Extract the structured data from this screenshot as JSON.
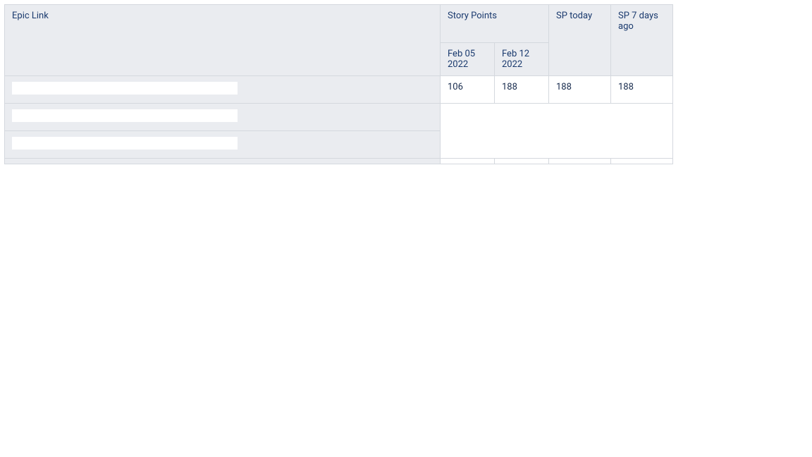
{
  "headers": {
    "epic_link": "Epic Link",
    "story_points": "Story Points",
    "sp_today": "SP today",
    "sp_7_days_ago": "SP 7 days ago",
    "date_1": "Feb 05 2022",
    "date_2": "Feb 12 2022"
  },
  "rows": [
    {
      "epic": "",
      "sp_feb05": 106,
      "sp_feb12": 188,
      "sp_today": 188,
      "sp_7days": 188
    },
    {
      "epic": "",
      "sp_feb05": null,
      "sp_feb12": null,
      "sp_today": null,
      "sp_7days": null
    },
    {
      "epic": "",
      "sp_feb05": null,
      "sp_feb12": null,
      "sp_today": null,
      "sp_7days": null
    }
  ],
  "chart_data": {
    "type": "table",
    "title": "",
    "row_dimension": "Epic Link",
    "columns": [
      {
        "group": "Story Points",
        "label": "Feb 05 2022"
      },
      {
        "group": "Story Points",
        "label": "Feb 12 2022"
      },
      {
        "group": "SP today",
        "label": "SP today"
      },
      {
        "group": "SP 7 days ago",
        "label": "SP 7 days ago"
      }
    ],
    "rows": [
      {
        "epic_link": "",
        "values": [
          106,
          188,
          188,
          188
        ]
      },
      {
        "epic_link": "",
        "values": [
          null,
          null,
          null,
          null
        ]
      },
      {
        "epic_link": "",
        "values": [
          null,
          null,
          null,
          null
        ]
      }
    ]
  }
}
